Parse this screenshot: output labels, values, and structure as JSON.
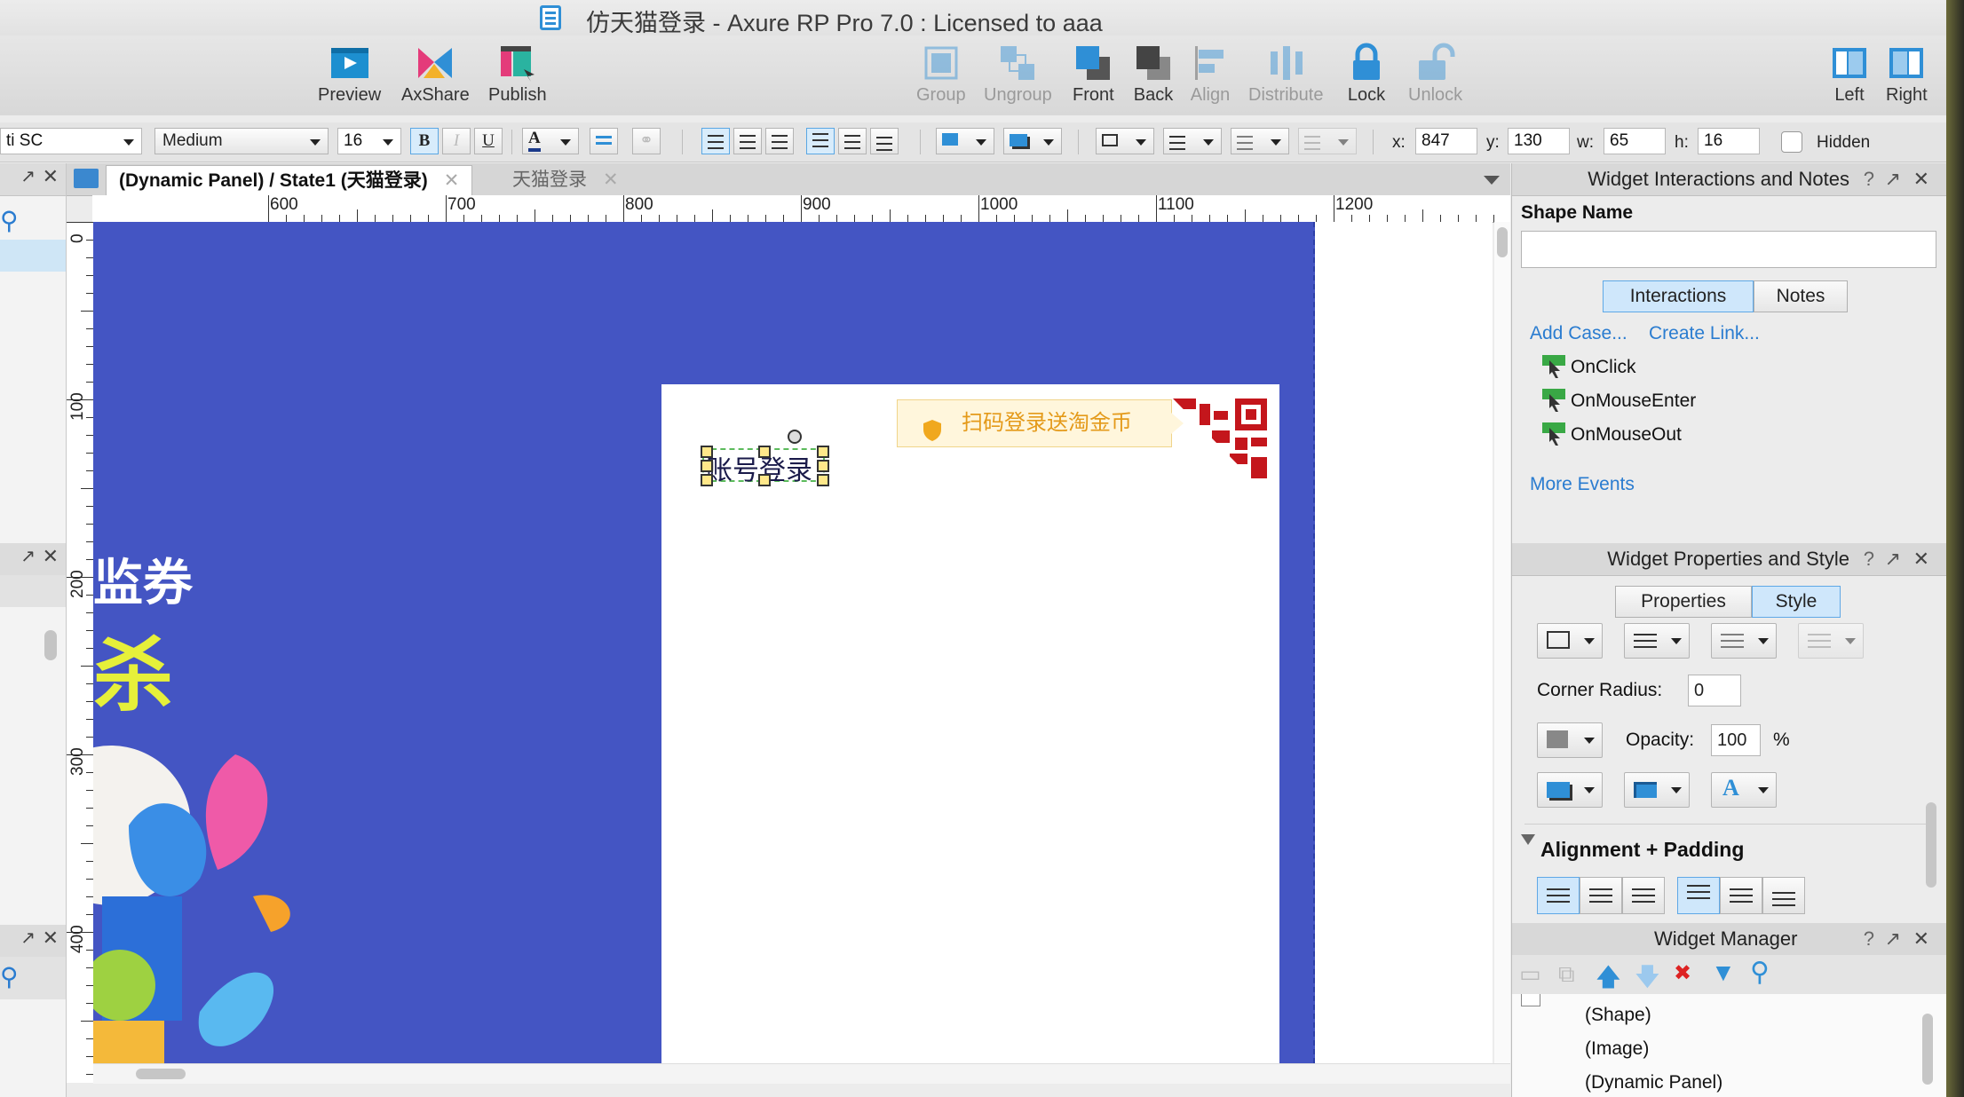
{
  "window": {
    "title": "仿天猫登录 - Axure RP Pro 7.0 : Licensed to aaa"
  },
  "toolbar": {
    "buttons": [
      {
        "label": "Preview"
      },
      {
        "label": "AxShare"
      },
      {
        "label": "Publish"
      },
      {
        "label": "Group"
      },
      {
        "label": "Ungroup"
      },
      {
        "label": "Front"
      },
      {
        "label": "Back"
      },
      {
        "label": "Align"
      },
      {
        "label": "Distribute"
      },
      {
        "label": "Lock"
      },
      {
        "label": "Unlock"
      },
      {
        "label": "Left"
      },
      {
        "label": "Right"
      }
    ]
  },
  "format": {
    "font_family": "ti SC",
    "font_weight": "Medium",
    "font_size": "16",
    "bold": "B",
    "italic": "I",
    "underline": "U",
    "x_label": "x:",
    "x": "847",
    "y_label": "y:",
    "y": "130",
    "w_label": "w:",
    "w": "65",
    "h_label": "h:",
    "h": "16",
    "hidden_label": "Hidden"
  },
  "tabs": [
    {
      "label": "(Dynamic Panel) / State1 (天猫登录)"
    },
    {
      "label": "天猫登录"
    }
  ],
  "ruler": {
    "h_labels": [
      "600",
      "700",
      "800",
      "900",
      "1000",
      "1100",
      "1200"
    ],
    "v_labels": [
      "0",
      "100",
      "200",
      "300",
      "400"
    ]
  },
  "canvas": {
    "qr_tip": "扫码登录送淘金币",
    "selected_text": "账号登录",
    "banner_text_1": "监券",
    "banner_text_2": "杀"
  },
  "interactions_panel": {
    "title": "Widget Interactions and Notes",
    "help": "?",
    "shape_name_label": "Shape Name",
    "shape_name_value": "",
    "tab_interactions": "Interactions",
    "tab_notes": "Notes",
    "add_case": "Add Case...",
    "create_link": "Create Link...",
    "events": [
      "OnClick",
      "OnMouseEnter",
      "OnMouseOut"
    ],
    "more_events": "More Events"
  },
  "properties_panel": {
    "title": "Widget Properties and Style",
    "help": "?",
    "tab_properties": "Properties",
    "tab_style": "Style",
    "corner_radius_label": "Corner Radius:",
    "corner_radius": "0",
    "opacity_label": "Opacity:",
    "opacity": "100",
    "opacity_unit": "%",
    "alignment_header": "Alignment + Padding"
  },
  "widget_manager": {
    "title": "Widget Manager",
    "help": "?",
    "items": [
      "(Shape)",
      "(Image)",
      "(Dynamic Panel)"
    ]
  },
  "colors": {
    "canvas_panel": "#4455c3",
    "accent": "#2a7cd0",
    "qr": "#c4161c"
  }
}
